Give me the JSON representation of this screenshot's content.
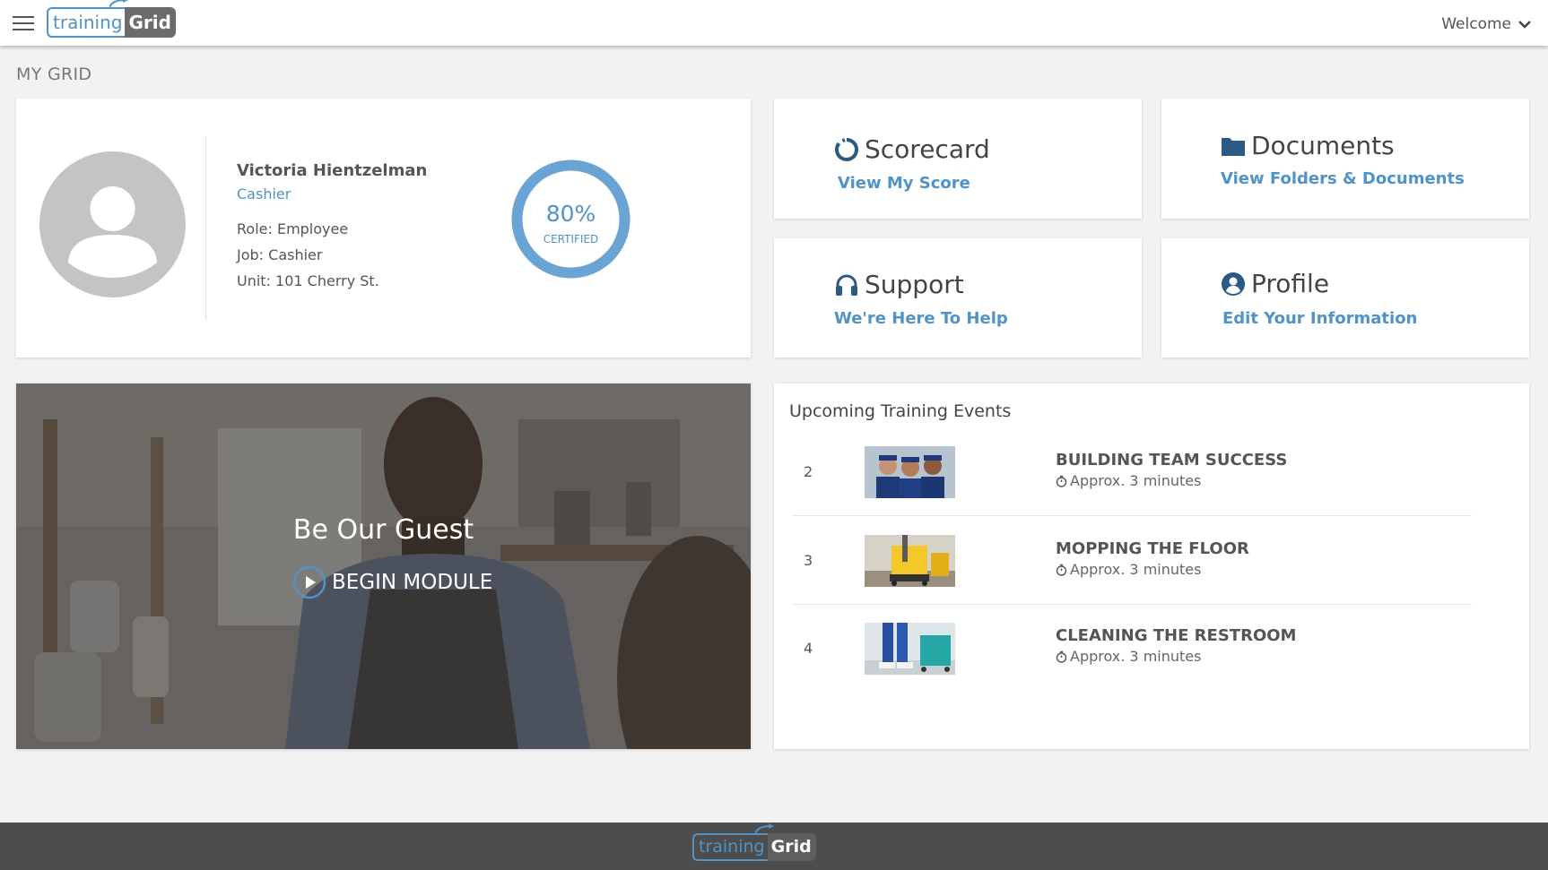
{
  "header": {
    "logo_training": "training",
    "logo_grid": "Grid",
    "welcome": "Welcome",
    "menu_icon": "hamburger-icon",
    "dropdown_icon": "chevron-down-icon"
  },
  "page_title": "MY GRID",
  "profile": {
    "name": "Victoria Hientzelman",
    "job_title": "Cashier",
    "role": "Role: Employee",
    "job": "Job: Cashier",
    "unit": "Unit: 101 Cherry St.",
    "certified_percent": 80,
    "certified_text": "80%",
    "certified_label": "CERTIFIED",
    "avatar_icon": "user-avatar-icon"
  },
  "tiles": {
    "scorecard": {
      "title": "Scorecard",
      "link": "View My Score",
      "icon": "scorecard-icon"
    },
    "documents": {
      "title": "Documents",
      "link": "View Folders & Documents",
      "icon": "folder-icon"
    },
    "support": {
      "title": "Support",
      "link": "We're Here To Help",
      "icon": "headset-icon"
    },
    "profile": {
      "title": "Profile",
      "link": "Edit Your Information",
      "icon": "user-circle-icon"
    }
  },
  "hero": {
    "title": "Be Our Guest",
    "button": "BEGIN MODULE",
    "icon": "play-circle-icon"
  },
  "events": {
    "title": "Upcoming Training Events",
    "items": [
      {
        "num": "2",
        "name": "BUILDING TEAM SUCCESS",
        "duration": "Approx. 3 minutes"
      },
      {
        "num": "3",
        "name": "MOPPING THE FLOOR",
        "duration": "Approx. 3 minutes"
      },
      {
        "num": "4",
        "name": "CLEANING THE RESTROOM",
        "duration": "Approx. 3 minutes"
      }
    ],
    "duration_icon": "stopwatch-icon"
  },
  "colors": {
    "accent": "#4f93c8",
    "accent_dark": "#2b5a86",
    "footer": "#4d4d4d",
    "background": "#f2f2f2"
  }
}
